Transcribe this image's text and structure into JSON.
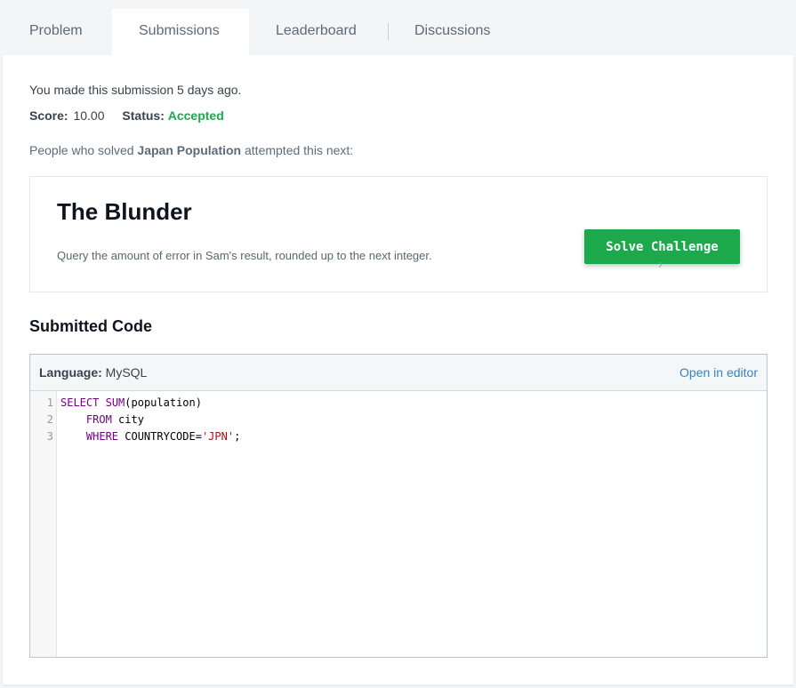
{
  "tabs": [
    {
      "label": "Problem",
      "active": false
    },
    {
      "label": "Submissions",
      "active": true
    },
    {
      "label": "Leaderboard",
      "active": false
    },
    {
      "label": "Discussions",
      "active": false
    }
  ],
  "submission": {
    "made_text": "You made this submission 5 days ago.",
    "score_label": "Score:",
    "score_value": "10.00",
    "status_label": "Status:",
    "status_value": "Accepted"
  },
  "next": {
    "prefix": "People who solved ",
    "challenge": "Japan Population",
    "suffix": " attempted this next:"
  },
  "recommendation": {
    "title": "The Blunder",
    "description": "Query the amount of error in Sam's result, rounded up to the next integer.",
    "button_label": "Solve Challenge"
  },
  "code": {
    "section_title": "Submitted Code",
    "language_label": "Language:",
    "language_value": "MySQL",
    "open_editor_label": "Open in editor",
    "line_numbers": [
      "1",
      "2",
      "3"
    ],
    "line1": {
      "kw1": "SELECT",
      "fn": "SUM",
      "rest": "(population)"
    },
    "line2": {
      "indent": "    ",
      "kw": "FROM",
      "rest": " city"
    },
    "line3": {
      "indent": "    ",
      "kw": "WHERE",
      "pre": " COUNTRYCODE=",
      "str": "'JPN'",
      "end": ";"
    }
  },
  "colors": {
    "accent_green": "#1ba94c",
    "link_blue": "#3a80c1"
  }
}
